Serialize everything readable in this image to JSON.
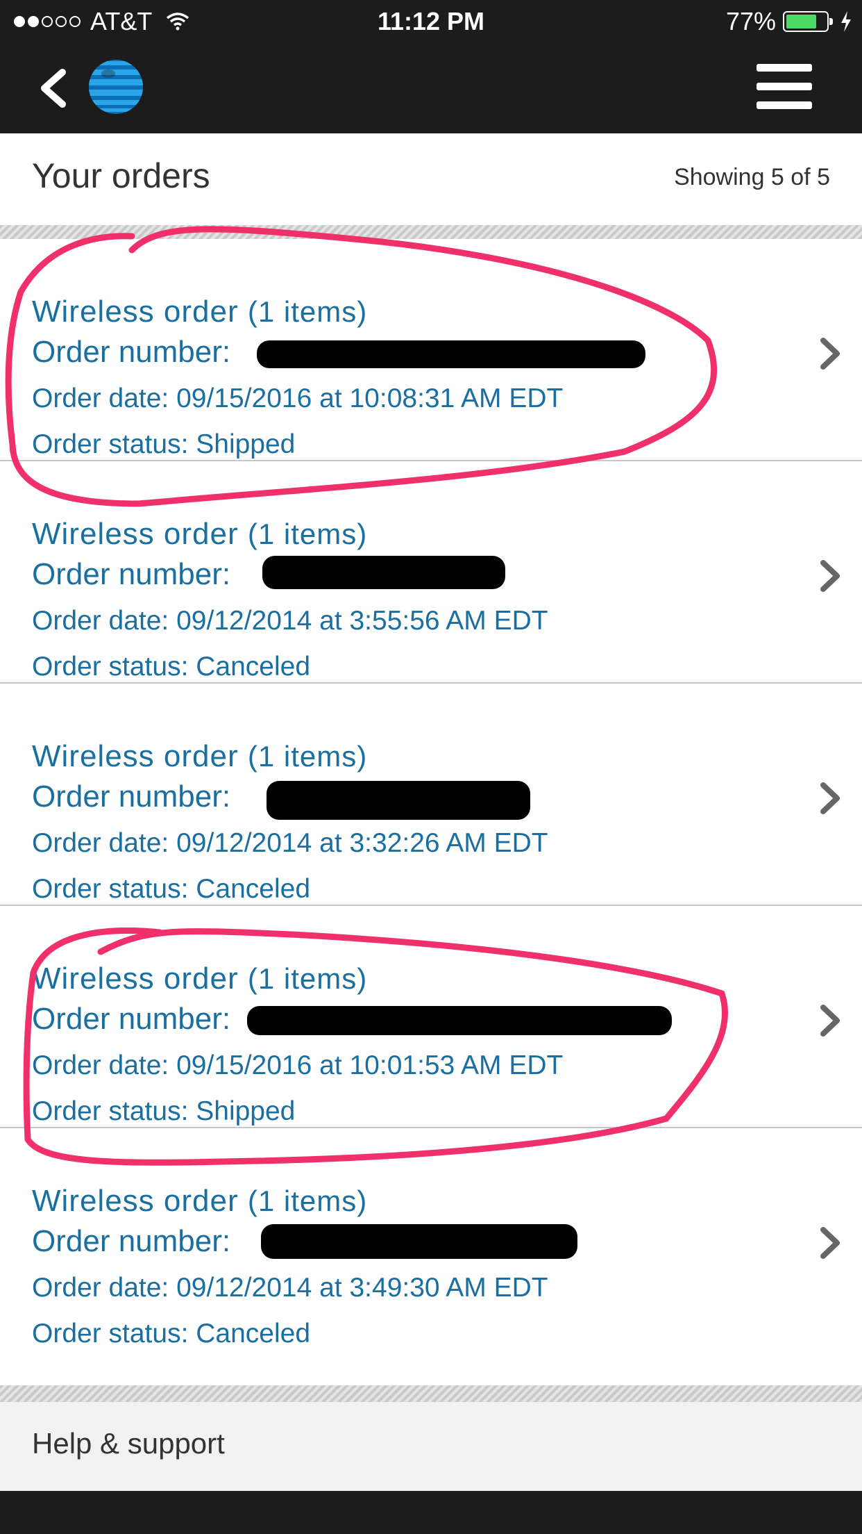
{
  "status_bar": {
    "carrier": "AT&T",
    "time": "11:12 PM",
    "battery": "77%",
    "battery_level": 0.77,
    "signal_bars": 2,
    "signal_max": 5
  },
  "nav": {
    "back_icon": "chevron-left-icon",
    "logo": "att-globe-logo",
    "menu_icon": "hamburger-menu-icon"
  },
  "header": {
    "title": "Your orders",
    "showing": "Showing 5 of 5"
  },
  "orders": [
    {
      "title": "Wireless order",
      "items": "(1 items)",
      "number_label": "Order number:",
      "date": "Order date: 09/15/2016 at 10:08:31 AM EDT",
      "status": "Order status: Shipped"
    },
    {
      "title": "Wireless order",
      "items": "(1 items)",
      "number_label": "Order number:",
      "date": "Order date: 09/12/2014 at 3:55:56 AM EDT",
      "status": "Order status: Canceled"
    },
    {
      "title": "Wireless order",
      "items": "(1 items)",
      "number_label": "Order number:",
      "date": "Order date: 09/12/2014 at 3:32:26 AM EDT",
      "status": "Order status: Canceled"
    },
    {
      "title": "Wireless order",
      "items": "(1 items)",
      "number_label": "Order number:",
      "date": "Order date: 09/15/2016 at 10:01:53 AM EDT",
      "status": "Order status: Shipped"
    },
    {
      "title": "Wireless order",
      "items": "(1 items)",
      "number_label": "Order number:",
      "date": "Order date: 09/12/2014 at 3:49:30 AM EDT",
      "status": "Order status: Canceled"
    }
  ],
  "footer": {
    "help": "Help & support"
  },
  "colors": {
    "bar": "#1c1c1c",
    "link": "#1a6fa0",
    "annotation": "#f0306a",
    "battery": "#4cd964"
  }
}
